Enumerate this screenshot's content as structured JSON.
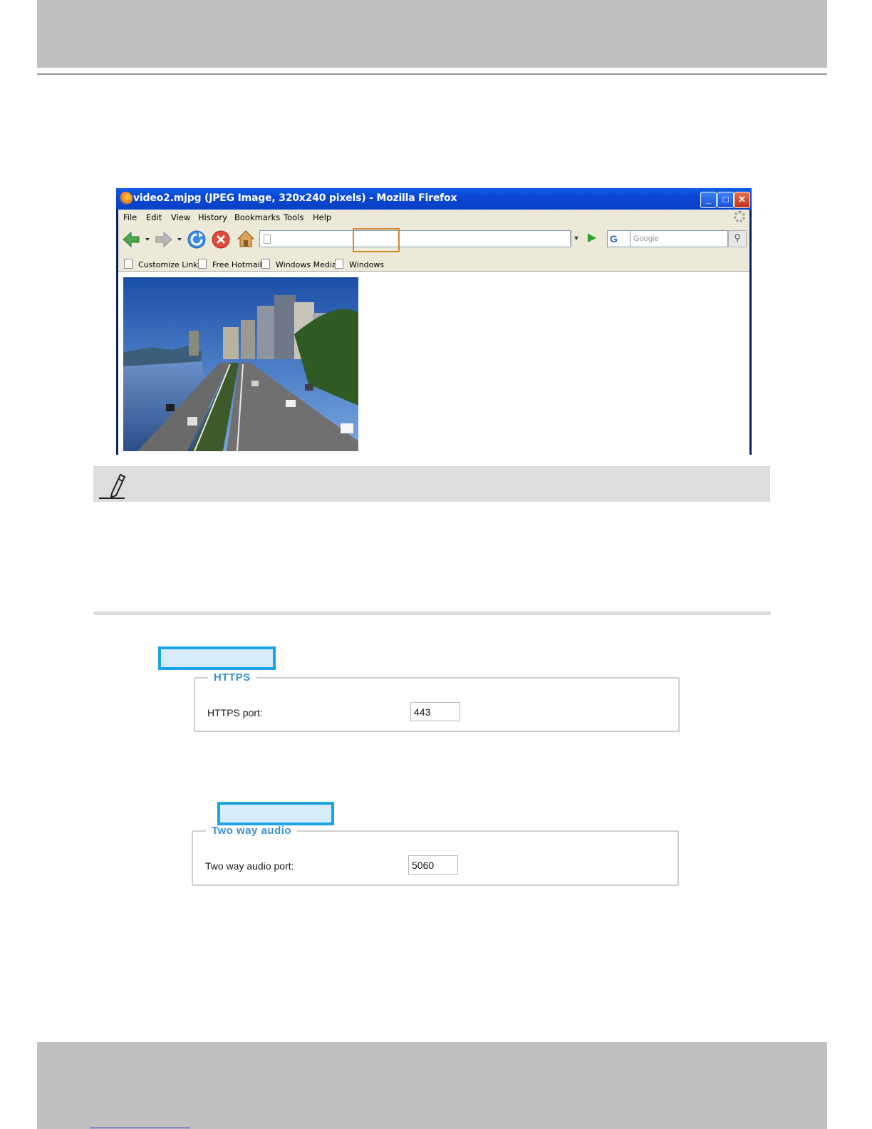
{
  "browser": {
    "title": "video2.mjpg (JPEG Image, 320x240 pixels) - Mozilla Firefox",
    "window_buttons": {
      "minimize": "_",
      "maximize": "□",
      "close": "✕"
    },
    "menu": [
      "File",
      "Edit",
      "View",
      "History",
      "Bookmarks",
      "Tools",
      "Help"
    ],
    "search_engine_glyph": "G",
    "search_placeholder": "Google",
    "bookmarks": [
      "Customize Links",
      "Free Hotmail",
      "Windows Media",
      "Windows"
    ]
  },
  "https_section": {
    "legend": "HTTPS",
    "label": "HTTPS port:",
    "value": "443"
  },
  "audio_section": {
    "legend": "Two way audio",
    "label": "Two way audio port:",
    "value": "5060"
  },
  "colors": {
    "header_gray": "#c0c0c0",
    "note_bar": "#dddddd",
    "highlight_border": "#1aa3e6",
    "legend_blue": "#3b8fd0",
    "url_callout": "#d08a30"
  },
  "icons": [
    "firefox-logo-icon",
    "back-arrow-icon",
    "forward-arrow-icon",
    "reload-icon",
    "stop-icon",
    "home-icon",
    "go-arrow-icon",
    "search-icon",
    "page-icon",
    "pencil-note-icon"
  ]
}
